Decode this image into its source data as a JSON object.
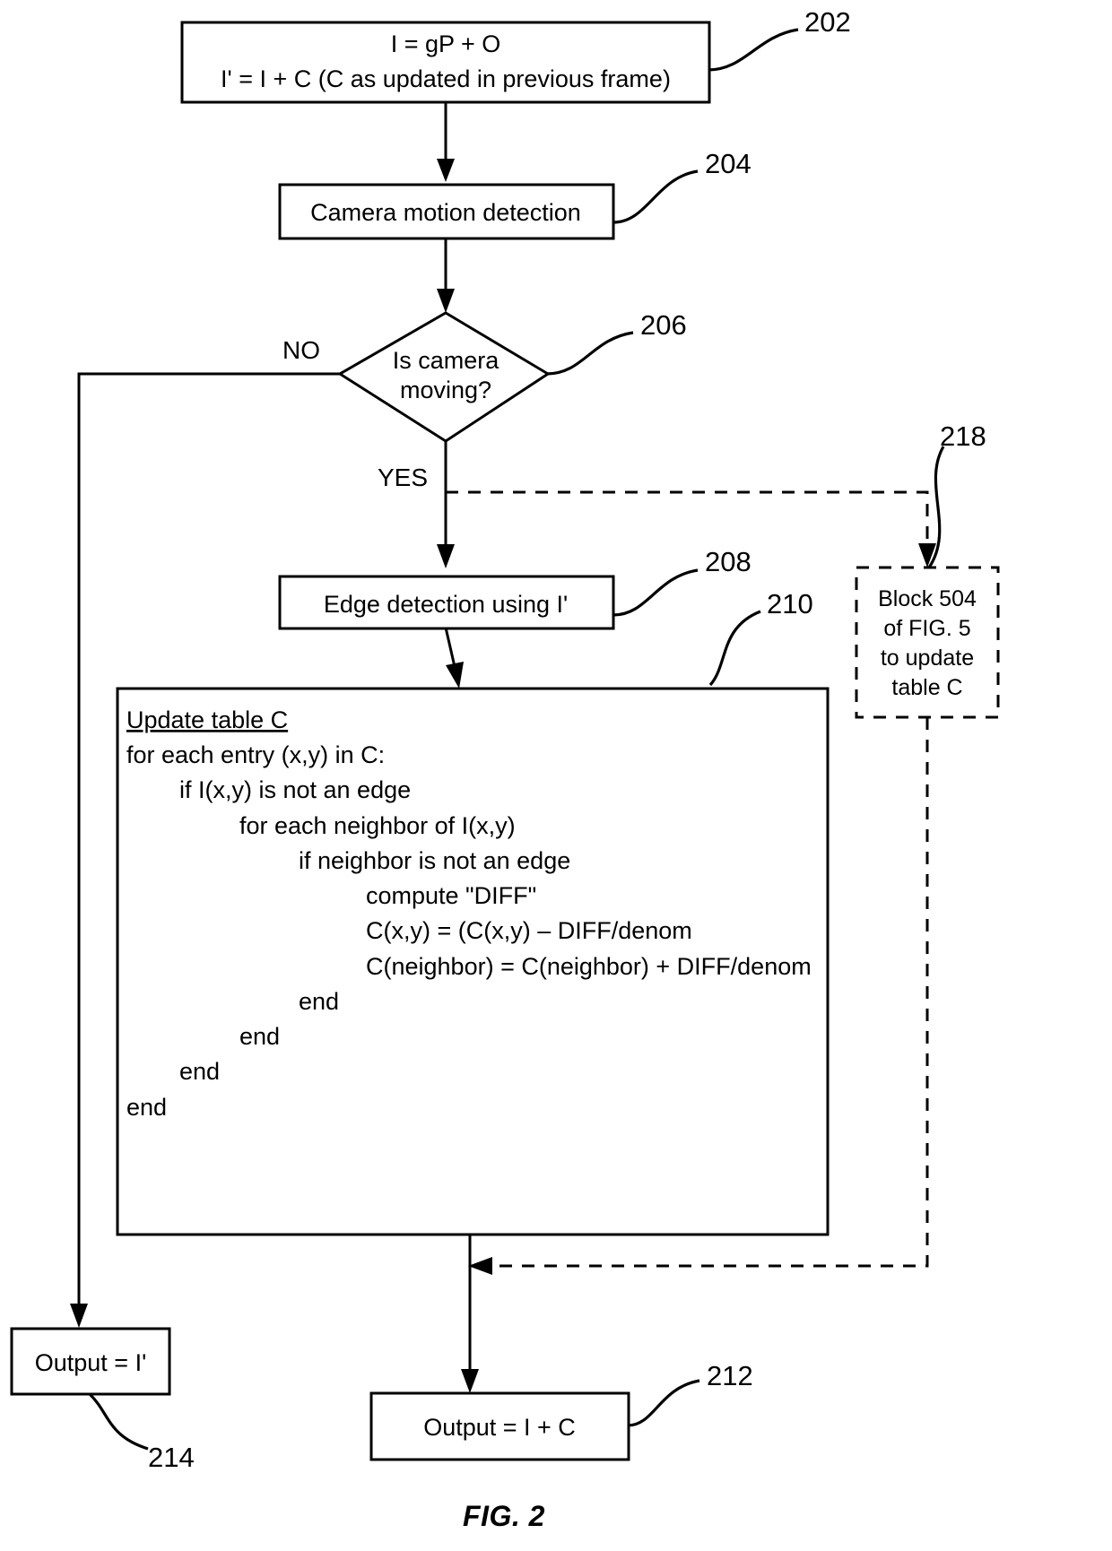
{
  "figure": {
    "caption": "FIG. 2"
  },
  "nodes": {
    "start_box": {
      "ref": "202",
      "lines": [
        "I = gP + O",
        "I' = I + C (C as updated in previous frame)"
      ]
    },
    "camera_motion": {
      "ref": "204",
      "label": "Camera motion detection"
    },
    "decision": {
      "ref": "206",
      "line1": "Is camera",
      "line2": "moving?",
      "branch_no": "NO",
      "branch_yes": "YES"
    },
    "edge_detection": {
      "ref": "208",
      "label": "Edge detection using I'"
    },
    "update_table": {
      "ref": "210",
      "title": "Update table C",
      "code": [
        "for each entry (x,y) in C:",
        "if I(x,y) is not an edge",
        "for each neighbor of I(x,y)",
        "if neighbor is not an edge",
        "compute \"DIFF\"",
        "C(x,y) = (C(x,y) – DIFF/denom",
        "C(neighbor) = C(neighbor) + DIFF/denom",
        "end",
        "end",
        "end",
        "end"
      ]
    },
    "block_504": {
      "ref": "218",
      "lines": [
        "Block 504",
        "of FIG. 5",
        "to update",
        "table C"
      ]
    },
    "output_iprime": {
      "ref": "214",
      "label": "Output = I'"
    },
    "output_ic": {
      "ref": "212",
      "label": "Output = I + C"
    }
  }
}
